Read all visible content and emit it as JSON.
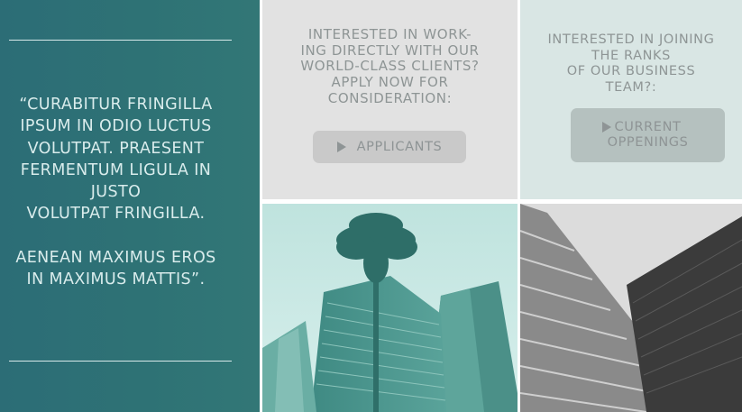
{
  "quote": {
    "text": "“CURABITUR FRINGILLA\nIPSUM IN ODIO LUCTUS\nVOLUTPAT. PRAESENT\nFERMENTUM LIGULA IN\nJUSTO\nVOLUTPAT FRINGILLA.\n\nAENEAN MAXIMUS EROS\nIN MAXIMUS MATTIS”."
  },
  "apply_card": {
    "text": "INTERESTED IN WORK-\nING DIRECTLY WITH OUR\nWORLD-CLASS CLIENTS?\nAPPLY NOW FOR\nCONSIDERATION:",
    "button_label": "APPLICANTS",
    "button_icon": "play-icon"
  },
  "join_card": {
    "text": "INTERESTED IN JOINING\nTHE RANKS\nOF OUR BUSINESS\nTEAM?:",
    "button_label": "CURRENT\nOPPENINGS",
    "button_icon": "play-icon"
  },
  "colors": {
    "quote_panel": "#2e7275",
    "apply_card": "#e2e2e2",
    "join_card": "#d9e6e4",
    "text_muted": "#8e9595"
  }
}
